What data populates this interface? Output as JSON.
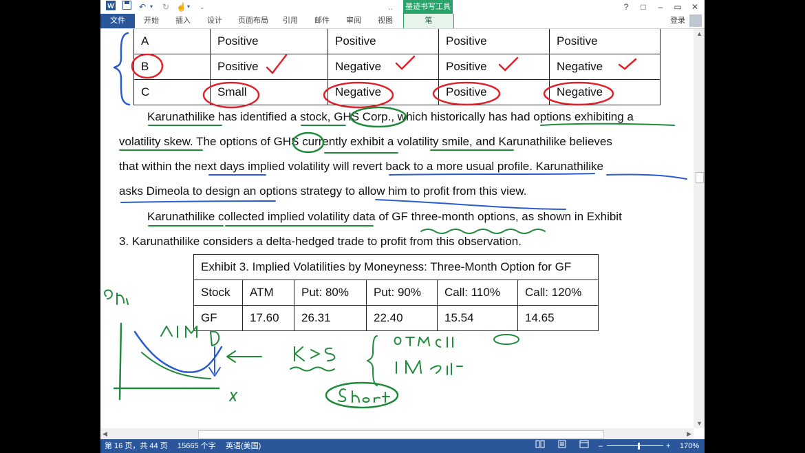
{
  "title_bar": {
    "ellipsis": "..",
    "tool_group": "墨迹书写工具",
    "help": "?",
    "restore_ribbon": "□",
    "minimize": "–",
    "maximize": "▭",
    "close": "✕"
  },
  "ribbon": {
    "tabs": [
      "文件",
      "开始",
      "插入",
      "设计",
      "页面布局",
      "引用",
      "邮件",
      "审阅",
      "视图",
      "笔"
    ],
    "login": "登录"
  },
  "document": {
    "table1": [
      [
        "A",
        "Positive",
        "Positive",
        "Positive",
        "Positive"
      ],
      [
        "B",
        "Positive",
        "Negative",
        "Positive",
        "Negative"
      ],
      [
        "C",
        "Small",
        "Negative",
        "Positive",
        "Negative"
      ]
    ],
    "para1": [
      "Karunathilike has identified a stock, GHS Corp., which historically has had options exhibiting a",
      "volatility skew. The options of GHS currently exhibit a volatility smile, and Karunathilike believes",
      "that within the next days implied volatility will revert back to a more usual profile. Karunathilike",
      "asks Dimeola to design an options strategy to allow him to profit from this view."
    ],
    "para2": [
      "Karunathilike collected implied volatility data of GF three-month options, as shown in Exhibit",
      "3. Karunathilike considers a delta-hedged trade to profit from this observation."
    ],
    "exhibit": {
      "title": "Exhibit 3. Implied Volatilities by Moneyness: Three-Month Option for GF",
      "headers": [
        "Stock",
        "ATM",
        "Put: 80%",
        "Put: 90%",
        "Call: 110%",
        "Call: 120%"
      ],
      "row": [
        "GF",
        "17.60",
        "26.31",
        "22.40",
        "15.54",
        "14.65"
      ]
    }
  },
  "status_bar": {
    "page": "第 16 页，共 44 页",
    "words": "15665 个字",
    "language": "英语(美国)",
    "zoom": "170%"
  },
  "colors": {
    "accent": "#2b579a",
    "ink_red": "#e0222a",
    "ink_green": "#1f8a3a",
    "ink_blue": "#2a5bd0"
  }
}
